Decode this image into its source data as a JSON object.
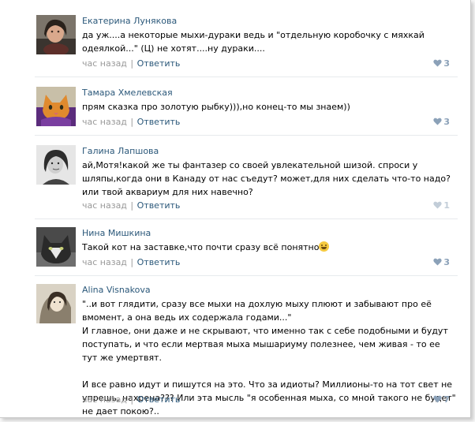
{
  "comments": [
    {
      "author": "Екатерина Лунякова",
      "paragraphs": [
        "да уж....а некоторые мыхи-дураки ведь и \"отдельную коробочку с мяхкай одеялкой...\" (Ц) не хотят....ну дураки...."
      ],
      "time": "час назад",
      "reply": "Ответить",
      "likes": "3",
      "avatar_icon": "profile-photo-woman"
    },
    {
      "author": "Тамара Хмелевская",
      "paragraphs": [
        "прям сказка про золотую рыбку))),но конец-то мы знаем))"
      ],
      "time": "час назад",
      "reply": "Ответить",
      "likes": "3",
      "avatar_icon": "profile-photo-cat"
    },
    {
      "author": "Галина Лапшова",
      "paragraphs": [
        "ай,Мотя!какой же ты фантазер со своей увлекательной шизой. спроси у шляпы,когда они в Канаду от нас съедут? может,для них сделать что-то надо? или твой аквариум для них навечно?"
      ],
      "time": "час назад",
      "reply": "Ответить",
      "likes": "1",
      "avatar_icon": "profile-photo-woman-bw"
    },
    {
      "author": "Нина Мишкина",
      "paragraphs": [
        "Такой кот на заставке,что почти сразу всё понятно"
      ],
      "emoji": "laughing-emoji",
      "time": "час назад",
      "reply": "Ответить",
      "likes": "3",
      "avatar_icon": "profile-photo-cat-dark"
    },
    {
      "author": "Alina Visnakova",
      "paragraphs": [
        "\"..и вот глядити, сразу все мыхи на дохлую мыху плюют и забывают про её вмомент, а она ведь их содержала годами...\"",
        "И главное, они даже и не скрывают, что именно так с себе подобными и будут поступать, и что если мертвая мыха мышариуму полезнее, чем живая - то ее тут же умертвят.",
        "",
        "И все равно идут и пишутся на это. Что за идиоты? Миллионы-то на тот свет не упрешь, нахрена??? Или эта мысль \"я особенная мыха, со мной такого не будет\" не дает покою?.."
      ],
      "time": "час назад",
      "reply": "Ответить",
      "likes": "7",
      "avatar_icon": "profile-photo-woman-sepia"
    }
  ],
  "colors": {
    "author_link": "#2b587a",
    "meta_gray": "#999999",
    "like_active": "#8ba1b8",
    "like_dim": "#c2cdd8",
    "divider": "#e7eaed"
  }
}
